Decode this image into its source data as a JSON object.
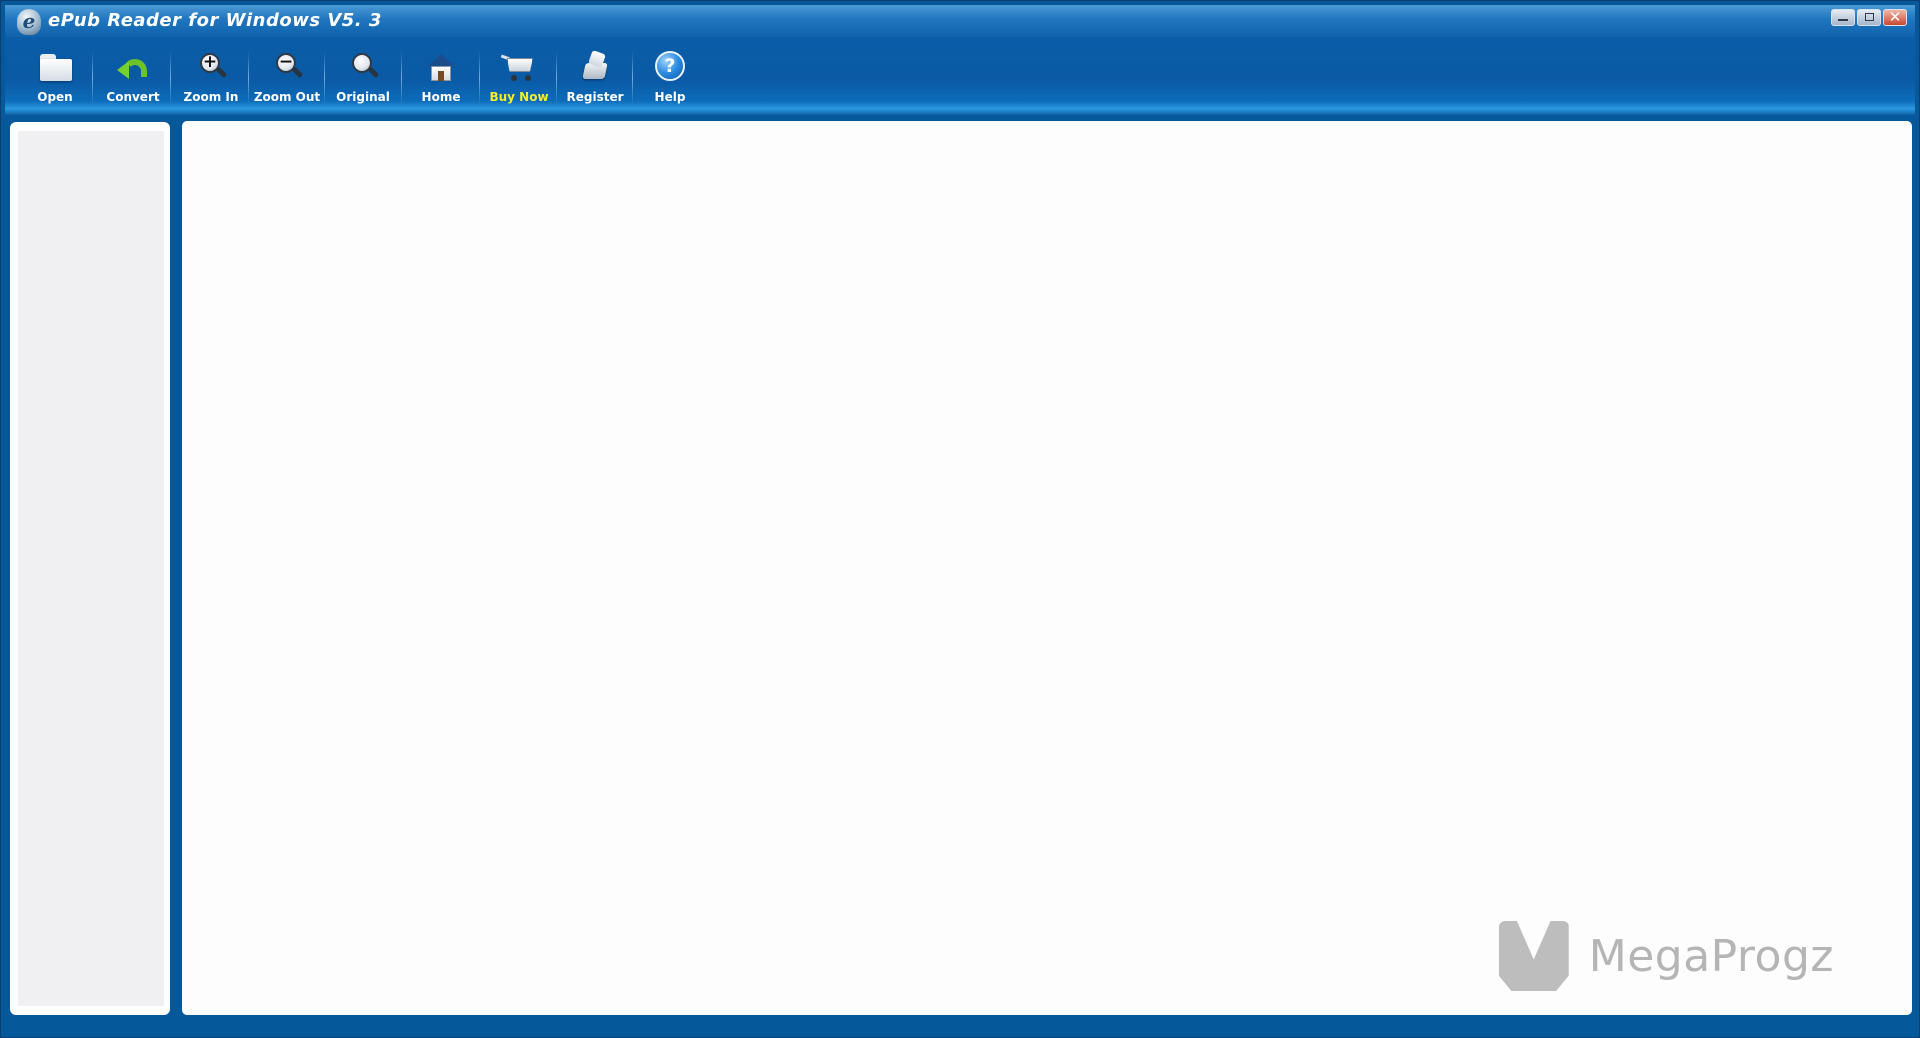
{
  "window": {
    "title": "ePub Reader for Windows V5. 3",
    "app_icon": "epub-e-icon",
    "app_icon_glyph": "e",
    "controls": {
      "minimize": "minimize-icon",
      "maximize": "restore-icon",
      "close": "close-icon",
      "close_glyph": "✕"
    }
  },
  "toolbar": {
    "items": [
      {
        "label": "Open",
        "icon": "folder-icon"
      },
      {
        "label": "Convert",
        "icon": "convert-arrow-icon"
      },
      {
        "label": "Zoom In",
        "icon": "zoom-in-icon",
        "glyph": "+"
      },
      {
        "label": "Zoom Out",
        "icon": "zoom-out-icon",
        "glyph": "−"
      },
      {
        "label": "Original",
        "icon": "magnifier-icon"
      },
      {
        "label": "Home",
        "icon": "home-icon"
      },
      {
        "label": "Buy Now",
        "icon": "cart-icon"
      },
      {
        "label": "Register",
        "icon": "register-icon"
      },
      {
        "label": "Help",
        "icon": "help-icon",
        "glyph": "?"
      }
    ],
    "buy_label_color": "#f5ee2a"
  },
  "watermark": {
    "text": "MegaProgz"
  },
  "colors": {
    "frame": "#05589a",
    "titlebar": "#1f75be",
    "panel": "#ffffff",
    "sidebar_inner": "#f0f0f2"
  }
}
